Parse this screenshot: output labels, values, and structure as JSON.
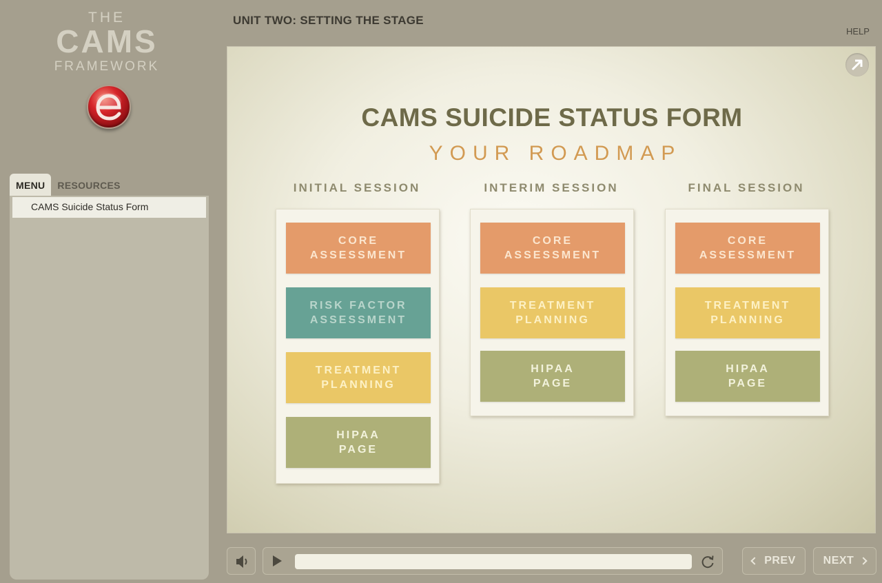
{
  "logo": {
    "line1": "THE",
    "line2": "CAMS",
    "line3": "FRAMEWORK",
    "badge_letter": "e"
  },
  "sidebar": {
    "tabs": [
      {
        "label": "MENU"
      },
      {
        "label": "RESOURCES"
      }
    ],
    "items": [
      {
        "label": "CAMS Suicide Status Form"
      }
    ]
  },
  "header": {
    "unit_title": "UNIT TWO: SETTING THE STAGE",
    "help": "HELP"
  },
  "slide": {
    "title": "CAMS SUICIDE STATUS FORM",
    "subtitle": "YOUR ROADMAP",
    "sessions": [
      {
        "heading": "INITIAL SESSION",
        "blocks": [
          {
            "line1": "CORE",
            "line2": "ASSESSMENT"
          },
          {
            "line1": "RISK FACTOR",
            "line2": "ASSESSMENT"
          },
          {
            "line1": "TREATMENT",
            "line2": "PLANNING"
          },
          {
            "line1": "HIPAA",
            "line2": "PAGE"
          }
        ]
      },
      {
        "heading": "INTERIM SESSION",
        "blocks": [
          {
            "line1": "CORE",
            "line2": "ASSESSMENT"
          },
          {
            "line1": "TREATMENT",
            "line2": "PLANNING"
          },
          {
            "line1": "HIPAA",
            "line2": "PAGE"
          }
        ]
      },
      {
        "heading": "FINAL SESSION",
        "blocks": [
          {
            "line1": "CORE",
            "line2": "ASSESSMENT"
          },
          {
            "line1": "TREATMENT",
            "line2": "PLANNING"
          },
          {
            "line1": "HIPAA",
            "line2": "PAGE"
          }
        ]
      }
    ]
  },
  "player": {
    "prev": "PREV",
    "next": "NEXT",
    "progress": 0
  },
  "colors": {
    "core": "#e49b6a",
    "risk": "#67a295",
    "treatment": "#eac766",
    "hipaa": "#aeb078",
    "title": "#6e6a49",
    "subtitle": "#d29a52"
  },
  "icons": {
    "popout": "arrow-up-right-icon",
    "volume": "speaker-icon",
    "play": "play-icon",
    "replay": "replay-icon"
  }
}
